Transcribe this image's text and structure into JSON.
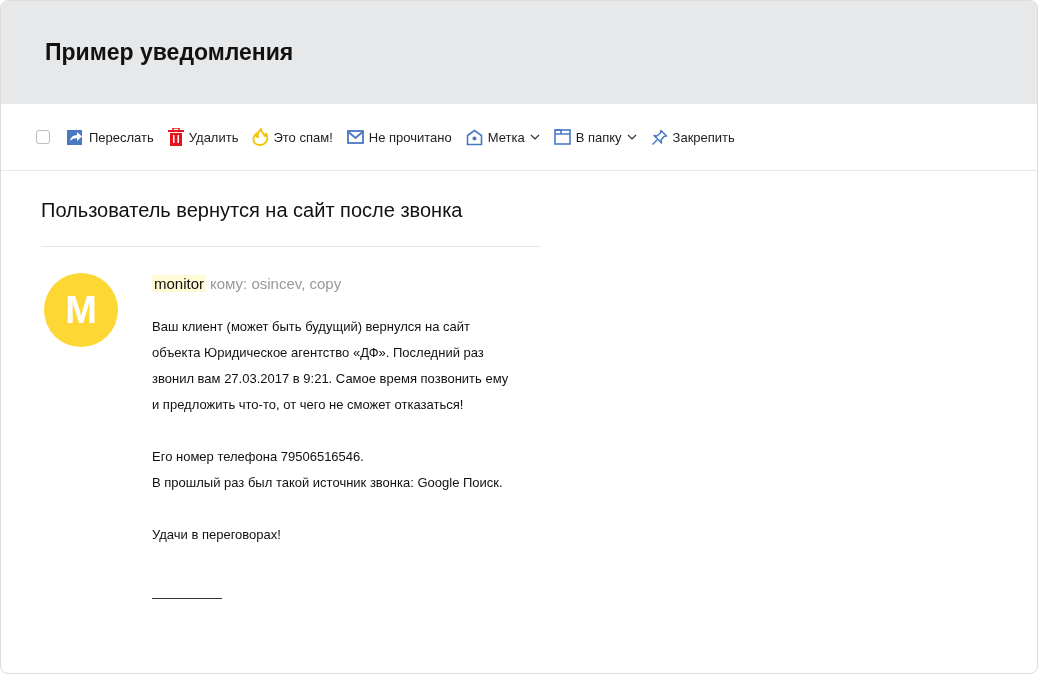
{
  "header": {
    "title": "Пример уведомления"
  },
  "toolbar": [
    {
      "kind": "checkbox",
      "checked": false
    },
    {
      "kind": "forward",
      "label": "Переслать",
      "dropdown": false
    },
    {
      "kind": "delete",
      "label": "Удалить",
      "dropdown": false
    },
    {
      "kind": "spam",
      "label": "Это спам!",
      "dropdown": false
    },
    {
      "kind": "unread",
      "label": "Не прочитано",
      "dropdown": false
    },
    {
      "kind": "tag",
      "label": "Метка",
      "dropdown": true
    },
    {
      "kind": "folder",
      "label": "В папку",
      "dropdown": true
    },
    {
      "kind": "pin",
      "label": "Закрепить",
      "dropdown": false
    }
  ],
  "message": {
    "subject": "Пользователь вернутся на сайт после звонка",
    "avatar": "M",
    "sender": "monitor",
    "recipients": "кому: osincev, copy",
    "paragraphs": [
      [
        "Ваш клиент (может быть будущий) вернулся на сайт",
        "объекта Юридическое агентство «ДФ».  Последний раз",
        "звонил вам 27.03.2017 в 9:21. Самое время позвонить ему",
        "и предложить что-то, от чего не сможет отказаться!"
      ],
      [
        "Его номер телефона 79506516546.",
        "В прошлый раз был такой источник звонка: Google Поиск."
      ],
      [
        "Удачи в переговорах!"
      ]
    ]
  }
}
